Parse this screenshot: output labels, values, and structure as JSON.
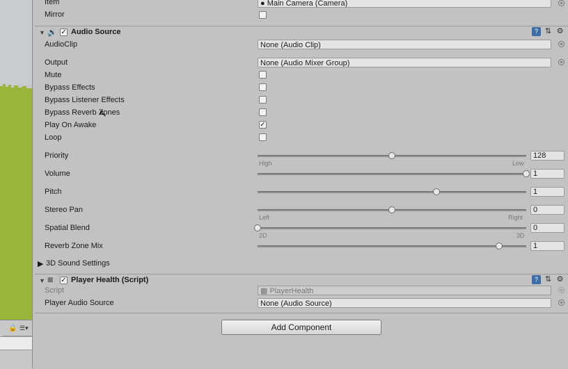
{
  "scene": {
    "visible_count": "17"
  },
  "top_rows": [
    {
      "label": "Item",
      "value": "Main Camera (Camera)"
    },
    {
      "label": "Mirror"
    }
  ],
  "audio_source": {
    "title": "Audio Source",
    "enabled": true,
    "audio_clip": {
      "label": "AudioClip",
      "value": "None (Audio Clip)"
    },
    "output": {
      "label": "Output",
      "value": "None (Audio Mixer Group)"
    },
    "toggles": [
      {
        "label": "Mute",
        "checked": false
      },
      {
        "label": "Bypass Effects",
        "checked": false
      },
      {
        "label": "Bypass Listener Effects",
        "checked": false
      },
      {
        "label": "Bypass Reverb Zones",
        "checked": false
      },
      {
        "label": "Play On Awake",
        "checked": true
      },
      {
        "label": "Loop",
        "checked": false
      }
    ],
    "sliders": [
      {
        "label": "Priority",
        "value": "128",
        "fraction": 0.5,
        "min_label": "High",
        "max_label": "Low"
      },
      {
        "label": "Volume",
        "value": "1",
        "fraction": 1.0
      },
      {
        "label": "Pitch",
        "value": "1",
        "fraction": 0.667
      },
      {
        "label": "Stereo Pan",
        "value": "0",
        "fraction": 0.5,
        "min_label": "Left",
        "max_label": "Right"
      },
      {
        "label": "Spatial Blend",
        "value": "0",
        "fraction": 0.0,
        "min_label": "2D",
        "max_label": "3D"
      },
      {
        "label": "Reverb Zone Mix",
        "value": "1",
        "fraction": 0.9
      }
    ],
    "settings_3d": "3D Sound Settings"
  },
  "player_health": {
    "title": "Player Health (Script)",
    "enabled": true,
    "script": {
      "label": "Script",
      "value": "PlayerHealth"
    },
    "audio": {
      "label": "Player Audio Source",
      "value": "None (Audio Source)"
    }
  },
  "add_component": "Add Component",
  "colors": {
    "ground": "#9ab63a",
    "panel": "#c2c2c2",
    "accent": "#3b6ea8"
  }
}
